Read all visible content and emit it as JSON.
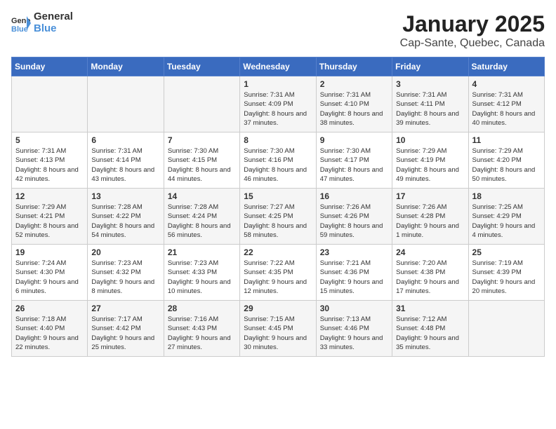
{
  "header": {
    "logo_general": "General",
    "logo_blue": "Blue",
    "month_title": "January 2025",
    "location": "Cap-Sante, Quebec, Canada"
  },
  "days_of_week": [
    "Sunday",
    "Monday",
    "Tuesday",
    "Wednesday",
    "Thursday",
    "Friday",
    "Saturday"
  ],
  "weeks": [
    [
      {
        "day": "",
        "info": ""
      },
      {
        "day": "",
        "info": ""
      },
      {
        "day": "",
        "info": ""
      },
      {
        "day": "1",
        "info": "Sunrise: 7:31 AM\nSunset: 4:09 PM\nDaylight: 8 hours and 37 minutes."
      },
      {
        "day": "2",
        "info": "Sunrise: 7:31 AM\nSunset: 4:10 PM\nDaylight: 8 hours and 38 minutes."
      },
      {
        "day": "3",
        "info": "Sunrise: 7:31 AM\nSunset: 4:11 PM\nDaylight: 8 hours and 39 minutes."
      },
      {
        "day": "4",
        "info": "Sunrise: 7:31 AM\nSunset: 4:12 PM\nDaylight: 8 hours and 40 minutes."
      }
    ],
    [
      {
        "day": "5",
        "info": "Sunrise: 7:31 AM\nSunset: 4:13 PM\nDaylight: 8 hours and 42 minutes."
      },
      {
        "day": "6",
        "info": "Sunrise: 7:31 AM\nSunset: 4:14 PM\nDaylight: 8 hours and 43 minutes."
      },
      {
        "day": "7",
        "info": "Sunrise: 7:30 AM\nSunset: 4:15 PM\nDaylight: 8 hours and 44 minutes."
      },
      {
        "day": "8",
        "info": "Sunrise: 7:30 AM\nSunset: 4:16 PM\nDaylight: 8 hours and 46 minutes."
      },
      {
        "day": "9",
        "info": "Sunrise: 7:30 AM\nSunset: 4:17 PM\nDaylight: 8 hours and 47 minutes."
      },
      {
        "day": "10",
        "info": "Sunrise: 7:29 AM\nSunset: 4:19 PM\nDaylight: 8 hours and 49 minutes."
      },
      {
        "day": "11",
        "info": "Sunrise: 7:29 AM\nSunset: 4:20 PM\nDaylight: 8 hours and 50 minutes."
      }
    ],
    [
      {
        "day": "12",
        "info": "Sunrise: 7:29 AM\nSunset: 4:21 PM\nDaylight: 8 hours and 52 minutes."
      },
      {
        "day": "13",
        "info": "Sunrise: 7:28 AM\nSunset: 4:22 PM\nDaylight: 8 hours and 54 minutes."
      },
      {
        "day": "14",
        "info": "Sunrise: 7:28 AM\nSunset: 4:24 PM\nDaylight: 8 hours and 56 minutes."
      },
      {
        "day": "15",
        "info": "Sunrise: 7:27 AM\nSunset: 4:25 PM\nDaylight: 8 hours and 58 minutes."
      },
      {
        "day": "16",
        "info": "Sunrise: 7:26 AM\nSunset: 4:26 PM\nDaylight: 8 hours and 59 minutes."
      },
      {
        "day": "17",
        "info": "Sunrise: 7:26 AM\nSunset: 4:28 PM\nDaylight: 9 hours and 1 minute."
      },
      {
        "day": "18",
        "info": "Sunrise: 7:25 AM\nSunset: 4:29 PM\nDaylight: 9 hours and 4 minutes."
      }
    ],
    [
      {
        "day": "19",
        "info": "Sunrise: 7:24 AM\nSunset: 4:30 PM\nDaylight: 9 hours and 6 minutes."
      },
      {
        "day": "20",
        "info": "Sunrise: 7:23 AM\nSunset: 4:32 PM\nDaylight: 9 hours and 8 minutes."
      },
      {
        "day": "21",
        "info": "Sunrise: 7:23 AM\nSunset: 4:33 PM\nDaylight: 9 hours and 10 minutes."
      },
      {
        "day": "22",
        "info": "Sunrise: 7:22 AM\nSunset: 4:35 PM\nDaylight: 9 hours and 12 minutes."
      },
      {
        "day": "23",
        "info": "Sunrise: 7:21 AM\nSunset: 4:36 PM\nDaylight: 9 hours and 15 minutes."
      },
      {
        "day": "24",
        "info": "Sunrise: 7:20 AM\nSunset: 4:38 PM\nDaylight: 9 hours and 17 minutes."
      },
      {
        "day": "25",
        "info": "Sunrise: 7:19 AM\nSunset: 4:39 PM\nDaylight: 9 hours and 20 minutes."
      }
    ],
    [
      {
        "day": "26",
        "info": "Sunrise: 7:18 AM\nSunset: 4:40 PM\nDaylight: 9 hours and 22 minutes."
      },
      {
        "day": "27",
        "info": "Sunrise: 7:17 AM\nSunset: 4:42 PM\nDaylight: 9 hours and 25 minutes."
      },
      {
        "day": "28",
        "info": "Sunrise: 7:16 AM\nSunset: 4:43 PM\nDaylight: 9 hours and 27 minutes."
      },
      {
        "day": "29",
        "info": "Sunrise: 7:15 AM\nSunset: 4:45 PM\nDaylight: 9 hours and 30 minutes."
      },
      {
        "day": "30",
        "info": "Sunrise: 7:13 AM\nSunset: 4:46 PM\nDaylight: 9 hours and 33 minutes."
      },
      {
        "day": "31",
        "info": "Sunrise: 7:12 AM\nSunset: 4:48 PM\nDaylight: 9 hours and 35 minutes."
      },
      {
        "day": "",
        "info": ""
      }
    ]
  ]
}
